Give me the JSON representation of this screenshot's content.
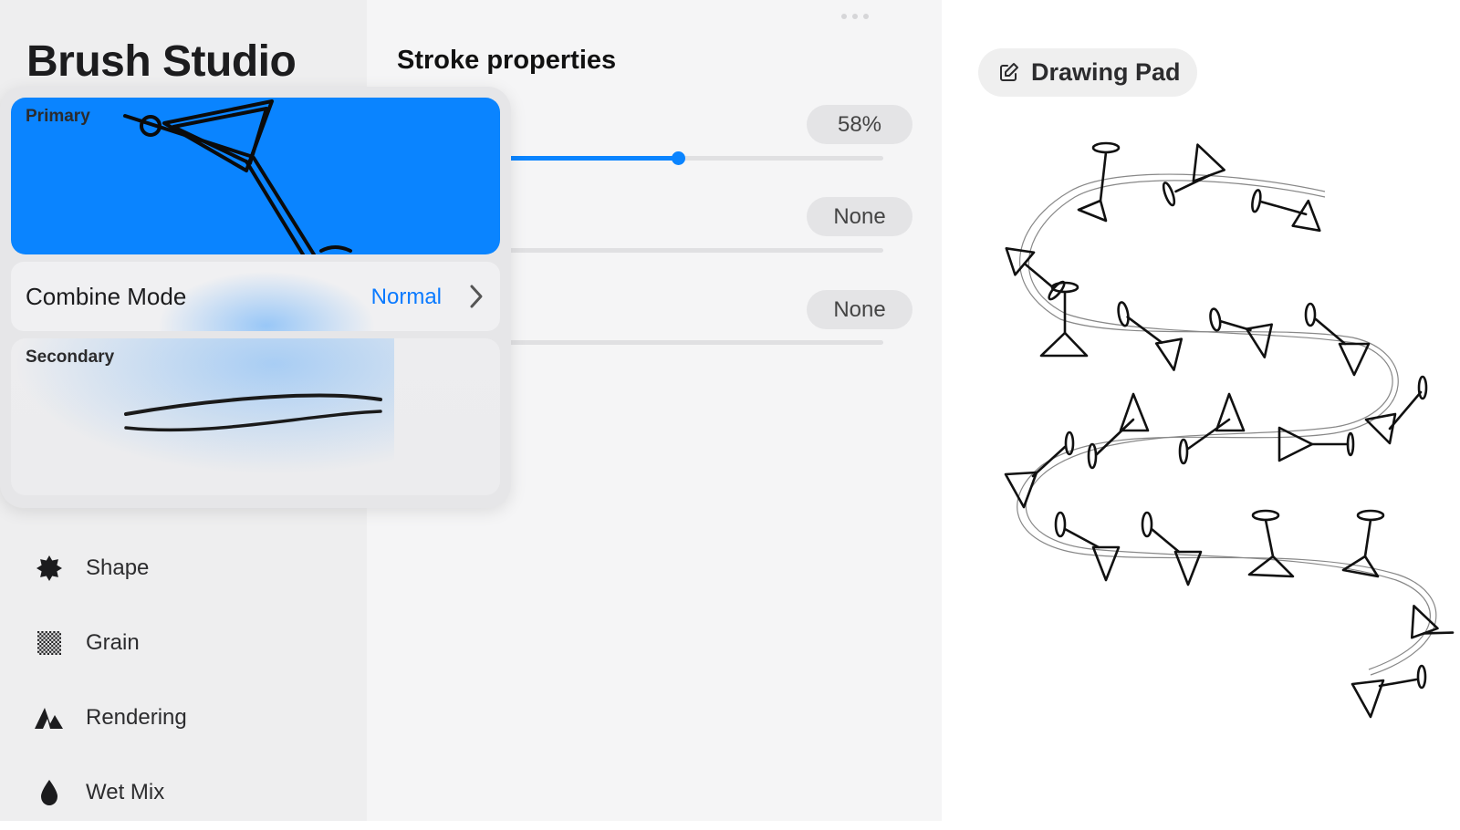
{
  "app": {
    "title": "Brush Studio"
  },
  "sidebar": {
    "items": [
      {
        "label": "Shape",
        "icon": "shape-icon"
      },
      {
        "label": "Grain",
        "icon": "grain-icon"
      },
      {
        "label": "Rendering",
        "icon": "rendering-icon"
      },
      {
        "label": "Wet Mix",
        "icon": "wet-mix-icon"
      }
    ]
  },
  "settings": {
    "title": "Stroke properties",
    "rows": [
      {
        "value": "58%",
        "level": 0.58
      },
      {
        "value": "None",
        "level": 0
      },
      {
        "value": "None",
        "level": 0
      }
    ]
  },
  "popover": {
    "primary_label": "Primary",
    "secondary_label": "Secondary",
    "combine_label": "Combine Mode",
    "combine_value": "Normal"
  },
  "pad": {
    "button_label": "Drawing Pad"
  },
  "colors": {
    "accent": "#0a84ff",
    "sidebar_bg": "#eeeeef",
    "settings_bg": "#f5f5f6"
  }
}
